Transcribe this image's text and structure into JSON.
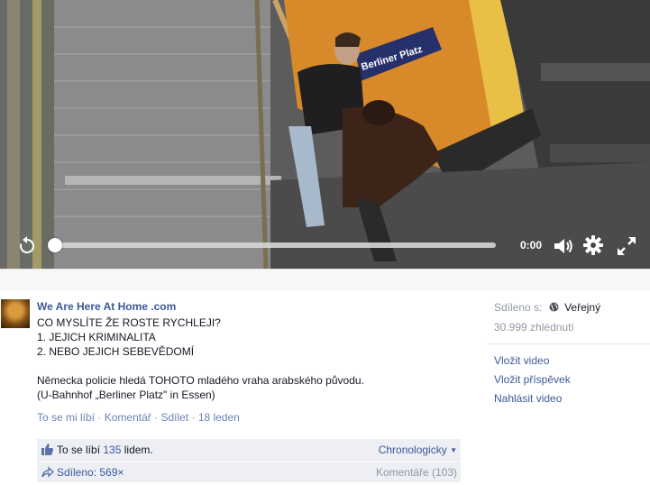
{
  "video": {
    "station_sign": "Berliner Platz",
    "time": "0:00",
    "progress": 0.0,
    "controls": [
      "replay-icon",
      "volume-icon",
      "gear-icon",
      "fullscreen-icon"
    ]
  },
  "post": {
    "author": "We Are Here At Home .com",
    "lines": [
      "CO MYSLÍTE ŽE ROSTE RYCHLEJI?",
      "1. JEJICH KRIMINALITA",
      "2. NEBO JEJICH SEBEVĚDOMÍ",
      "",
      "Německa policie hledá TOHOTO mladého vraha arabského původu.",
      "(U-Bahnhof „Berliner Platz\" in Essen)"
    ],
    "actions": {
      "like": "To se mi líbí",
      "comment": "Komentář",
      "share": "Sdílet",
      "date": "18 leden",
      "separator": "·"
    },
    "likes": {
      "prefix": "To se líbí",
      "count": "135",
      "suffix": "lidem.",
      "sort": "Chronologicky"
    },
    "shares": {
      "label": "Sdíleno: 569×",
      "comments": "Komentáře (103)"
    }
  },
  "sidebar": {
    "shared_label": "Sdíleno s:",
    "audience": "Veřejný",
    "views": "30.999 zhlédnutí",
    "links": [
      "Vložit video",
      "Vložit příspěvek",
      "Nahlásit video"
    ]
  },
  "colors": {
    "link": "#3b5998",
    "muted": "#9197a3",
    "bar_bg": "#edeff4"
  }
}
